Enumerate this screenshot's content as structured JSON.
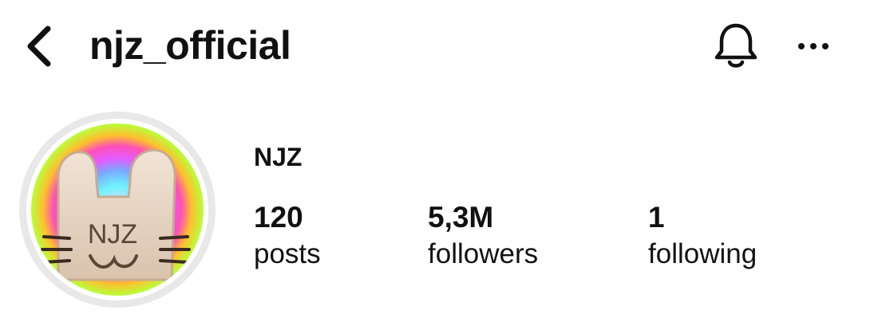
{
  "header": {
    "back_icon": "chevron-left-icon",
    "username": "njz_official",
    "bell_icon": "bell-icon",
    "more_icon": "more-horizontal-icon"
  },
  "profile": {
    "display_name": "NJZ",
    "avatar_text": "NJZ",
    "stats": [
      {
        "value": "120",
        "label": "posts"
      },
      {
        "value": "5,3M",
        "label": "followers"
      },
      {
        "value": "1",
        "label": "following"
      }
    ]
  },
  "colors": {
    "text": "#111111",
    "background": "#ffffff",
    "avatar_ring": "#e8e8e8"
  }
}
